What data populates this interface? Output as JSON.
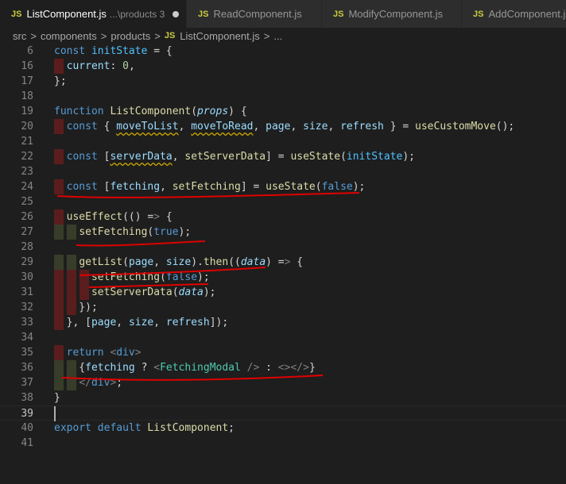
{
  "tabs": [
    {
      "label": "ListComponent.js",
      "description": "...\\products 3",
      "active": true,
      "modified": true
    },
    {
      "label": "ReadComponent.js",
      "active": false
    },
    {
      "label": "ModifyComponent.js",
      "active": false
    },
    {
      "label": "AddComponent.js",
      "active": false
    }
  ],
  "js_badge": "JS",
  "breadcrumb": {
    "items": [
      "src",
      "components",
      "products",
      "ListComponent.js",
      "..."
    ],
    "separator": ">"
  },
  "editor": {
    "lines": [
      {
        "n": "6",
        "segs": [
          [
            "kw",
            "const "
          ],
          [
            "cst",
            "initState"
          ],
          [
            "",
            "="
          ],
          [
            "",
            ""
          ]
        ]
      },
      {
        "n": "16",
        "segs": []
      },
      {
        "n": "17",
        "segs": []
      },
      {
        "n": "18",
        "segs": []
      },
      {
        "n": "19",
        "segs": []
      },
      {
        "n": "20",
        "segs": []
      },
      {
        "n": "21",
        "segs": []
      },
      {
        "n": "22",
        "segs": []
      },
      {
        "n": "23",
        "segs": []
      },
      {
        "n": "24",
        "segs": []
      },
      {
        "n": "25",
        "segs": []
      },
      {
        "n": "26",
        "segs": []
      },
      {
        "n": "27",
        "segs": []
      },
      {
        "n": "28",
        "segs": []
      },
      {
        "n": "29",
        "segs": []
      },
      {
        "n": "30",
        "segs": []
      },
      {
        "n": "31",
        "segs": []
      },
      {
        "n": "32",
        "segs": []
      },
      {
        "n": "33",
        "segs": []
      },
      {
        "n": "34",
        "segs": []
      },
      {
        "n": "35",
        "segs": []
      },
      {
        "n": "36",
        "segs": []
      },
      {
        "n": "37",
        "segs": []
      },
      {
        "n": "38",
        "segs": []
      },
      {
        "n": "39",
        "segs": []
      },
      {
        "n": "40",
        "segs": []
      },
      {
        "n": "41",
        "segs": []
      }
    ],
    "line_numbers": [
      "6",
      "16",
      "17",
      "18",
      "19",
      "20",
      "21",
      "22",
      "23",
      "24",
      "25",
      "26",
      "27",
      "28",
      "29",
      "30",
      "31",
      "32",
      "33",
      "34",
      "35",
      "36",
      "37",
      "38",
      "39",
      "40",
      "41"
    ],
    "code": [
      "const initState = {",
      "  current: 0,",
      "};",
      "",
      "function ListComponent(props) {",
      "  const { moveToList, moveToRead, page, size, refresh } = useCustomMove();",
      "",
      "  const [serverData, setServerData] = useState(initState);",
      "",
      "  const [fetching, setFetching] = useState(false);",
      "",
      "  useEffect(() => {",
      "    setFetching(true);",
      "",
      "    getList(page, size).then((data) => {",
      "      setFetching(false);",
      "      setServerData(data);",
      "    });",
      "  }, [page, size, refresh]);",
      "",
      "  return <div>",
      "    {fetching ? <FetchingModal /> : <></>}",
      "    </div>;",
      "}",
      "",
      "export default ListComponent;",
      ""
    ],
    "current_line": "39"
  },
  "colors": {
    "background": "#1e1e1e",
    "keyword": "#569cd6",
    "function": "#dcdcaa",
    "variable": "#9cdcfe",
    "constant": "#4fc1ff",
    "number": "#b5cea8",
    "component": "#4ec9b0",
    "annotation": "#ff0000"
  }
}
